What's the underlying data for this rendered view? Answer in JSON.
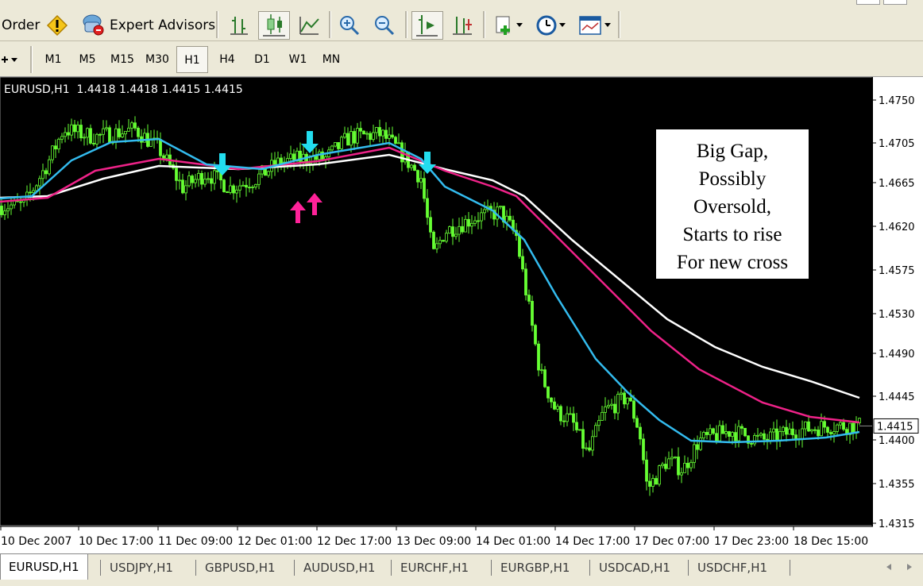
{
  "toolbar": {
    "order_label": "Order",
    "expert_advisors_label": "Expert Advisors"
  },
  "timeframes": [
    "M1",
    "M5",
    "M15",
    "M30",
    "H1",
    "H4",
    "D1",
    "W1",
    "MN"
  ],
  "active_timeframe": "H1",
  "chart": {
    "info_line": "EURUSD,H1  1.4418 1.4418 1.4415 1.4415",
    "current_price": "1.4415",
    "price_ticks": [
      "1.4750",
      "1.4705",
      "1.4665",
      "1.4620",
      "1.4575",
      "1.4530",
      "1.4490",
      "1.4445",
      "1.4400",
      "1.4355",
      "1.4315"
    ],
    "time_ticks": [
      "10 Dec 2007",
      "10 Dec 17:00",
      "11 Dec 09:00",
      "12 Dec 01:00",
      "12 Dec 17:00",
      "13 Dec 09:00",
      "14 Dec 01:00",
      "14 Dec 17:00",
      "17 Dec 07:00",
      "17 Dec 23:00",
      "18 Dec 15:00"
    ],
    "colors": {
      "background": "#000000",
      "candle": "#66ff33",
      "ma_fast": "#33bbee",
      "ma_mid": "#ee2288",
      "ma_slow": "#ffffff",
      "sell_arrow": "#22ddee",
      "buy_arrow": "#ff2299"
    }
  },
  "annotation": {
    "lines": [
      "Big Gap,",
      "Possibly",
      "Oversold,",
      "Starts to rise",
      "For new cross"
    ]
  },
  "tabs": [
    "EURUSD,H1",
    "USDJPY,H1",
    "GBPUSD,H1",
    "AUDUSD,H1",
    "EURCHF,H1",
    "EURGBP,H1",
    "USDCAD,H1",
    "USDCHF,H1"
  ],
  "active_tab": "EURUSD,H1"
}
